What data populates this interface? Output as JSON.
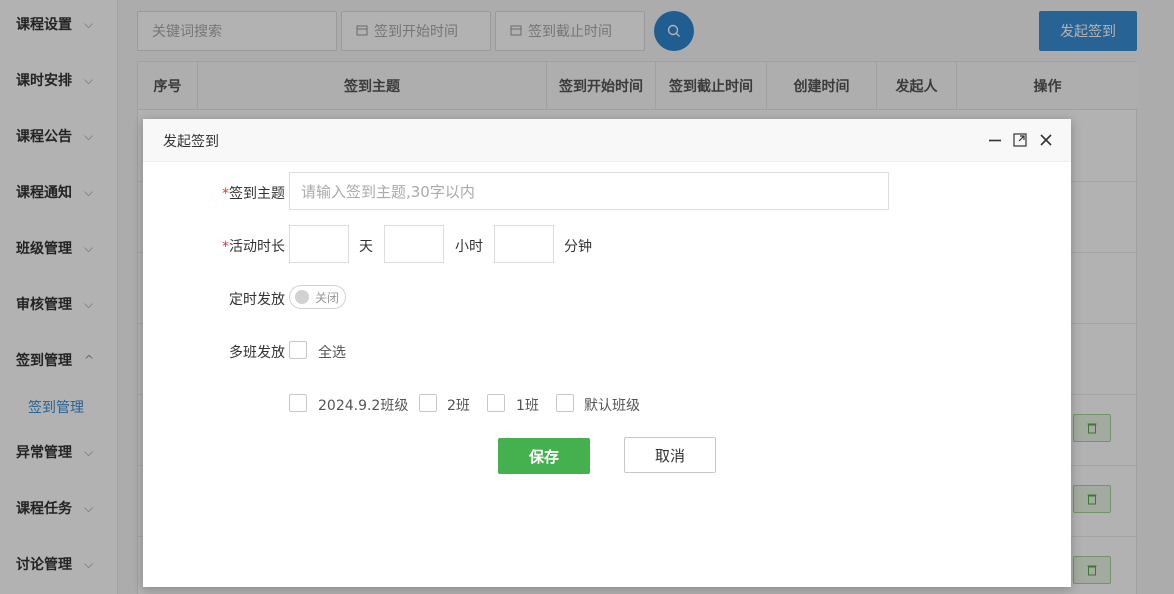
{
  "sidebar": {
    "items": [
      {
        "label": "课程设置"
      },
      {
        "label": "课时安排"
      },
      {
        "label": "课程公告"
      },
      {
        "label": "课程通知"
      },
      {
        "label": "班级管理"
      },
      {
        "label": "审核管理"
      },
      {
        "label": "签到管理"
      },
      {
        "label": "异常管理"
      },
      {
        "label": "课程任务"
      },
      {
        "label": "讨论管理"
      }
    ],
    "active_sub": "签到管理",
    "chevron_down": "⌵",
    "chevron_up": "^"
  },
  "toolbar": {
    "search_placeholder": "关键词搜索",
    "start_placeholder": "签到开始时间",
    "end_placeholder": "签到截止时间",
    "launch_label": "发起签到"
  },
  "table": {
    "headers": [
      "序号",
      "签到主题",
      "签到开始时间",
      "签到截止时间",
      "创建时间",
      "发起人",
      "操作"
    ]
  },
  "modal": {
    "title": "发起签到",
    "required_mark": "*",
    "topic_label": "签到主题",
    "topic_placeholder": "请输入签到主题,30字以内",
    "duration_label": "活动时长",
    "unit_day": "天",
    "unit_hour": "小时",
    "unit_minute": "分钟",
    "timed_label": "定时发放",
    "toggle_off": "关闭",
    "multi_label": "多班发放",
    "select_all": "全选",
    "classes": [
      "2024.9.2班级",
      "2班",
      "1班",
      "默认班级"
    ],
    "save": "保存",
    "cancel": "取消"
  }
}
